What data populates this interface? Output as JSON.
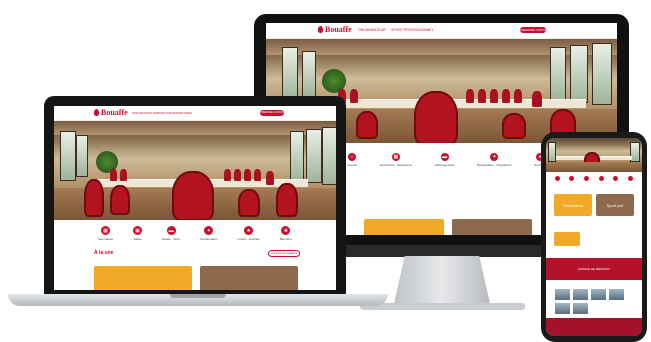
{
  "brand": {
    "name": "Bouaffe",
    "accent": "#c8102e"
  },
  "monitor": {
    "nav": {
      "links": [
        "ORGANISATEUR",
        "SPORT PROFESSIONNEL"
      ],
      "cta": "PRENDRE CONTACT"
    },
    "icons": [
      {
        "label": "Accueil",
        "icon": "home-icon"
      },
      {
        "label": "Séminaires · Réceptions",
        "icon": "calendar-icon"
      },
      {
        "label": "Hébergements",
        "icon": "bed-icon"
      },
      {
        "label": "Restauration · Prestations",
        "icon": "food-icon"
      },
      {
        "label": "Services",
        "icon": "service-icon"
      }
    ]
  },
  "laptop": {
    "nav": {
      "links": [
        "ORGANISATEUR",
        "SPORT PROFESSIONNEL"
      ],
      "cta": "PRENDRE CONTACT"
    },
    "icons": [
      {
        "label": "Séminaires",
        "icon": "calendar-icon"
      },
      {
        "label": "Salles",
        "icon": "room-icon"
      },
      {
        "label": "Hôtels · Gîtes",
        "icon": "bed-icon"
      },
      {
        "label": "Restauration",
        "icon": "food-icon"
      },
      {
        "label": "Loisirs · Activités",
        "icon": "activity-icon"
      },
      {
        "label": "Bien-être",
        "icon": "spa-icon"
      }
    ],
    "section_title": "À la une",
    "see_all": "Voir toutes les actualités"
  },
  "phone": {
    "cards": [
      {
        "label": "Séminaires"
      },
      {
        "label": "Sport pro"
      }
    ],
    "banner": "ESPACE DE RÉUNION"
  }
}
